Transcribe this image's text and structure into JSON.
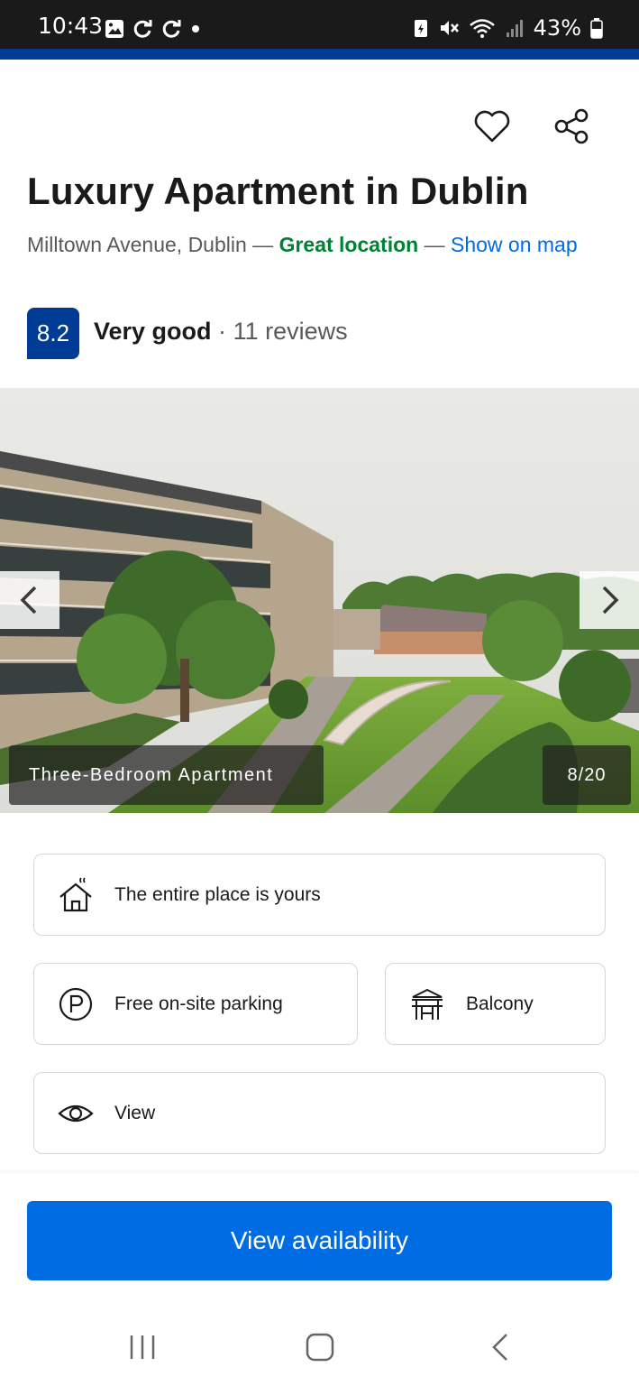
{
  "status_bar": {
    "time": "10:43",
    "battery": "43%"
  },
  "property": {
    "title": "Luxury Apartment in Dublin",
    "address": "Milltown Avenue, Dublin",
    "separator": "—",
    "location_badge": "Great location",
    "map_link": "Show on map",
    "score": "8.2",
    "rating_word": "Very good",
    "dot": "·",
    "reviews": "11 reviews"
  },
  "gallery": {
    "caption": "Three-Bedroom Apartment",
    "counter": "8/20"
  },
  "facilities": [
    {
      "icon": "house-icon",
      "label": "The entire place is yours"
    },
    {
      "icon": "parking-icon",
      "label": "Free on-site parking"
    },
    {
      "icon": "balcony-icon",
      "label": "Balcony"
    },
    {
      "icon": "eye-icon",
      "label": "View"
    }
  ],
  "cta": {
    "label": "View availability"
  },
  "colors": {
    "brand_blue": "#003b95",
    "action_blue": "#006ce4",
    "great_green": "#008234"
  }
}
